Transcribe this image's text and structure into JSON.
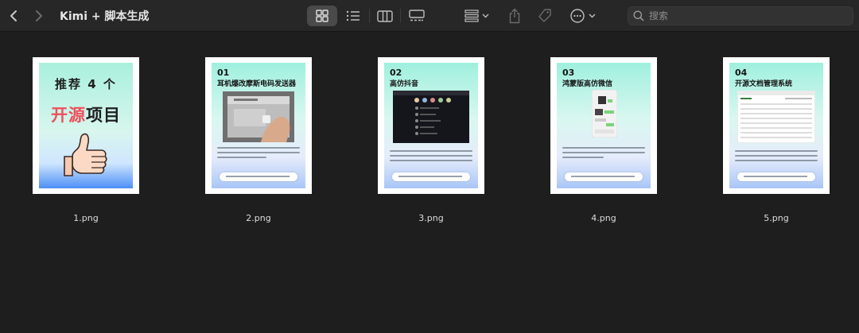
{
  "window": {
    "title": "Kimi + 脚本生成"
  },
  "toolbar": {
    "search_placeholder": "搜索",
    "icons": [
      "chevron-left-icon",
      "chevron-right-icon",
      "grid-view-icon",
      "list-view-icon",
      "column-view-icon",
      "gallery-view-icon",
      "group-icon",
      "share-icon",
      "tag-icon",
      "more-icon",
      "search-icon"
    ],
    "active_view": "grid-view-icon"
  },
  "cover": {
    "line1": "推荐 4 个",
    "line2_a": "开源",
    "line2_b": "项目"
  },
  "pages": [
    {
      "num": "01",
      "title": "耳机爆改摩斯电码发送器"
    },
    {
      "num": "02",
      "title": "高仿抖音"
    },
    {
      "num": "03",
      "title": "鸿蒙版高仿微信"
    },
    {
      "num": "04",
      "title": "开源文档管理系统"
    }
  ],
  "files": [
    {
      "name": "1.png"
    },
    {
      "name": "2.png"
    },
    {
      "name": "3.png"
    },
    {
      "name": "4.png"
    },
    {
      "name": "5.png"
    }
  ],
  "colors": {
    "background": "#1e1e1e",
    "toolbar": "#272727",
    "accent_red": "#ef4f5a"
  }
}
